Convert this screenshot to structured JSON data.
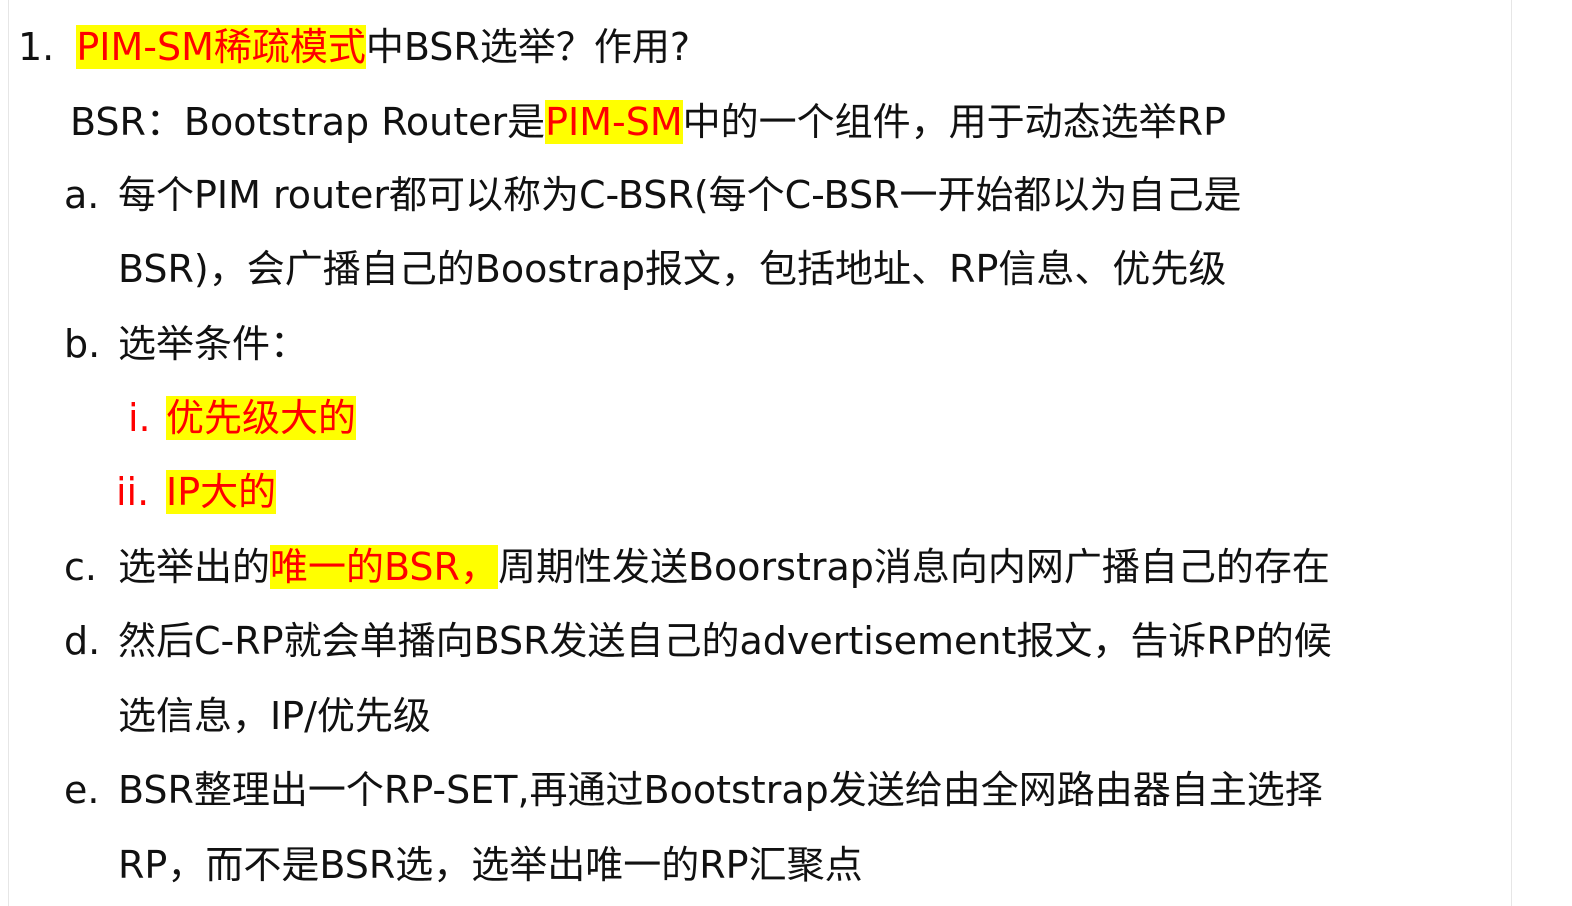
{
  "item1": {
    "number": "1.",
    "title_highlight": "PIM-SM稀疏模式",
    "title_rest": "中BSR选举？作用?"
  },
  "bsr_def": {
    "prefix": "BSR：Bootstrap Router是",
    "highlight": "PIM-SM",
    "suffix": "中的一个组件，用于动态选举RP"
  },
  "a": {
    "marker": "a.",
    "line1": "每个PIM router都可以称为C-BSR(每个C-BSR一开始都以为自己是",
    "line2": "BSR)，会广播自己的Boostrap报文，包括地址、RP信息、优先级"
  },
  "b": {
    "marker": "b.",
    "text": "选举条件：",
    "sub": [
      {
        "marker": "i.",
        "text": "优先级大的"
      },
      {
        "marker": "ii.",
        "text": "IP大的"
      }
    ]
  },
  "c": {
    "marker": "c.",
    "prefix": "选举出的",
    "highlight": "唯一的BSR，",
    "suffix": "周期性发送Boorstrap消息向内网广播自己的存在"
  },
  "d": {
    "marker": "d.",
    "line1": "然后C-RP就会单播向BSR发送自己的advertisement报文，告诉RP的候",
    "line2": "选信息，IP/优先级"
  },
  "e": {
    "marker": "e.",
    "line1": "BSR整理出一个RP-SET,再通过Bootstrap发送给由全网路由器自主选择",
    "line2": "RP，而不是BSR选，选举出唯一的RP汇聚点"
  },
  "colors": {
    "highlight": "#ffff00",
    "emphasis_text": "#ff0000",
    "body_text": "#111111"
  }
}
